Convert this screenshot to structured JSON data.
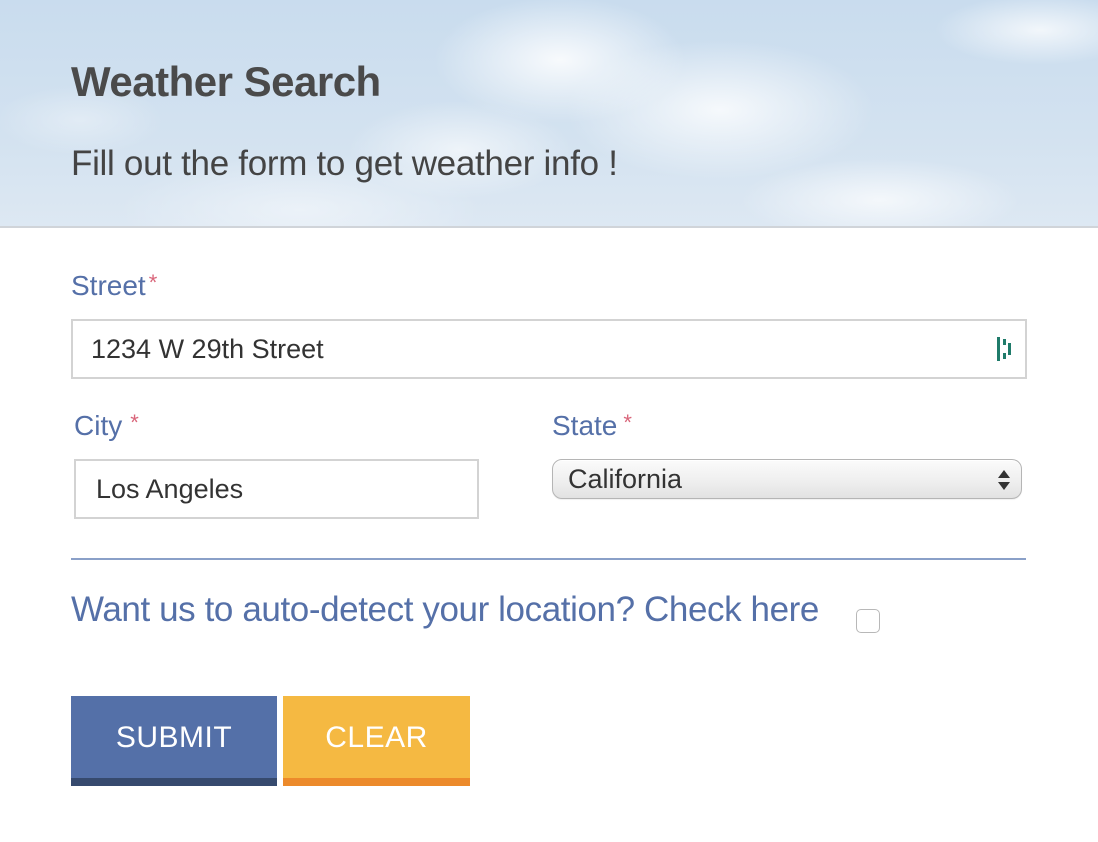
{
  "header": {
    "title": "Weather Search",
    "subtitle": "Fill out the form to get weather info !"
  },
  "form": {
    "street": {
      "label": "Street",
      "required_mark": "*",
      "value": "1234 W 29th Street"
    },
    "city": {
      "label": "City",
      "required_mark": "*",
      "value": "Los Angeles"
    },
    "state": {
      "label": "State",
      "required_mark": "*",
      "selected": "California"
    },
    "auto_detect": {
      "text": "Want us to auto-detect your location? Check here",
      "checked": false
    },
    "buttons": {
      "submit": "SUBMIT",
      "clear": "CLEAR"
    }
  },
  "colors": {
    "label_blue": "#5570a8",
    "required_pink": "#d9657a",
    "submit_bg": "#5470a8",
    "clear_bg": "#f5b942"
  },
  "icons": {
    "street_field_icon": "autofill-icon",
    "state_select_icon": "select-arrows-icon"
  }
}
